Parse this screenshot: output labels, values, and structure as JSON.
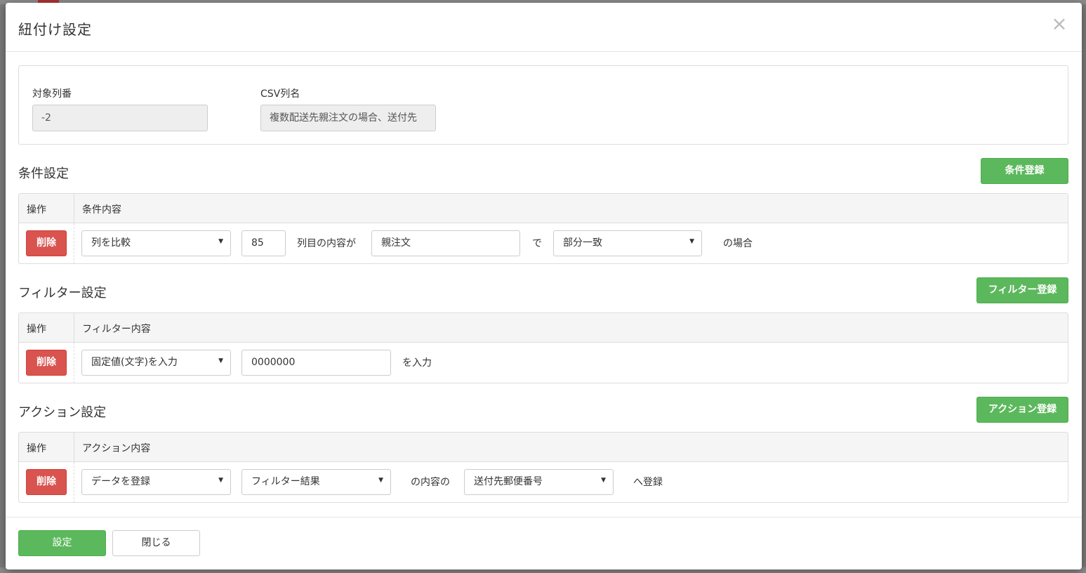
{
  "modal": {
    "title": "紐付け設定",
    "close_glyph": "×"
  },
  "target": {
    "column_number_label": "対象列番",
    "column_number_value": "-2",
    "csv_name_label": "CSV列名",
    "csv_name_value": "複数配送先親注文の場合、送付先"
  },
  "condition": {
    "title": "条件設定",
    "register_label": "条件登録",
    "header_op": "操作",
    "header_content": "条件内容",
    "delete_label": "削除",
    "select_type": "列を比較",
    "column_input": "85",
    "text_column_content": "列目の内容が",
    "value_input": "親注文",
    "text_de": "で",
    "select_match": "部分一致",
    "text_case": "の場合"
  },
  "filter": {
    "title": "フィルター設定",
    "register_label": "フィルター登録",
    "header_op": "操作",
    "header_content": "フィルター内容",
    "delete_label": "削除",
    "select_type": "固定値(文字)を入力",
    "value_input": "0000000",
    "text_input_suffix": "を入力"
  },
  "action": {
    "title": "アクション設定",
    "register_label": "アクション登録",
    "header_op": "操作",
    "header_content": "アクション内容",
    "delete_label": "削除",
    "select_type": "データを登録",
    "select_source": "フィルター結果",
    "text_content_of": "の内容の",
    "select_target": "送付先郵便番号",
    "text_register_to": "へ登録"
  },
  "footer": {
    "submit_label": "設定",
    "close_label": "閉じる"
  },
  "colors": {
    "green": "#5cb85c",
    "red": "#d9534f"
  },
  "icons": {
    "close": "close-icon",
    "dropdown": "caret-down-icon"
  }
}
